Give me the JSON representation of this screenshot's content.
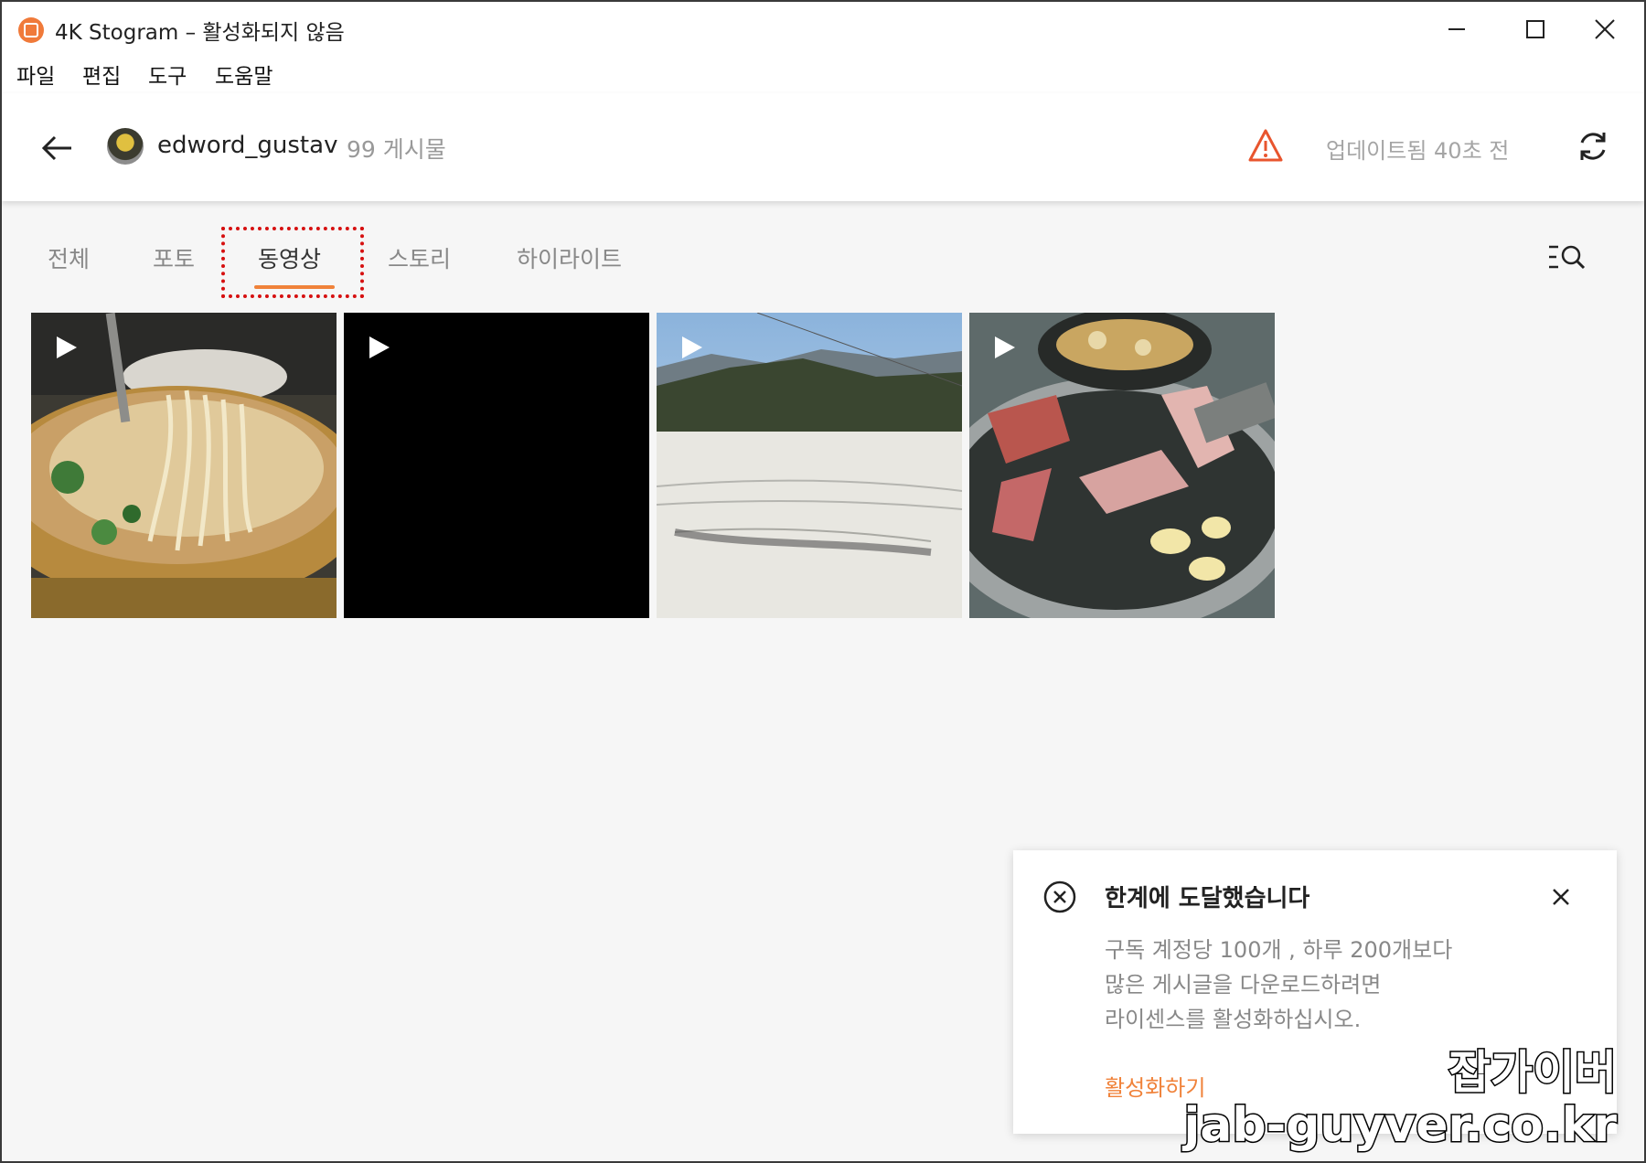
{
  "window": {
    "title": "4K Stogram – 활성화되지 않음",
    "controls": {
      "minimize": "minimize-icon",
      "maximize": "maximize-icon",
      "close": "close-icon"
    }
  },
  "menu": [
    "파일",
    "편집",
    "도구",
    "도움말"
  ],
  "header": {
    "username": "edword_gustav",
    "post_count": "99 게시물",
    "updated": "업데이트됨 40초 전"
  },
  "tabs": [
    {
      "label": "전체",
      "active": false
    },
    {
      "label": "포토",
      "active": false
    },
    {
      "label": "동영상",
      "active": true
    },
    {
      "label": "스토리",
      "active": false
    },
    {
      "label": "하이라이트",
      "active": false
    }
  ],
  "media": [
    {
      "kind": "video",
      "scene": "noodle-hotpot"
    },
    {
      "kind": "video",
      "scene": "black"
    },
    {
      "kind": "video",
      "scene": "snowy-mountain-lake"
    },
    {
      "kind": "video",
      "scene": "korean-bbq-grill"
    }
  ],
  "toast": {
    "title": "한계에 도달했습니다",
    "body_lines": [
      "구독 계정당 100개 , 하루 200개보다",
      "많은 게시글을 다운로드하려면",
      "라이센스를 활성화하십시오."
    ],
    "action": "활성화하기"
  },
  "watermark": {
    "line1": "잡가이버",
    "line2": "jab-guyver.co.kr"
  },
  "colors": {
    "accent": "#f0823a",
    "highlight": "#d61010",
    "warning": "#e8552e"
  }
}
